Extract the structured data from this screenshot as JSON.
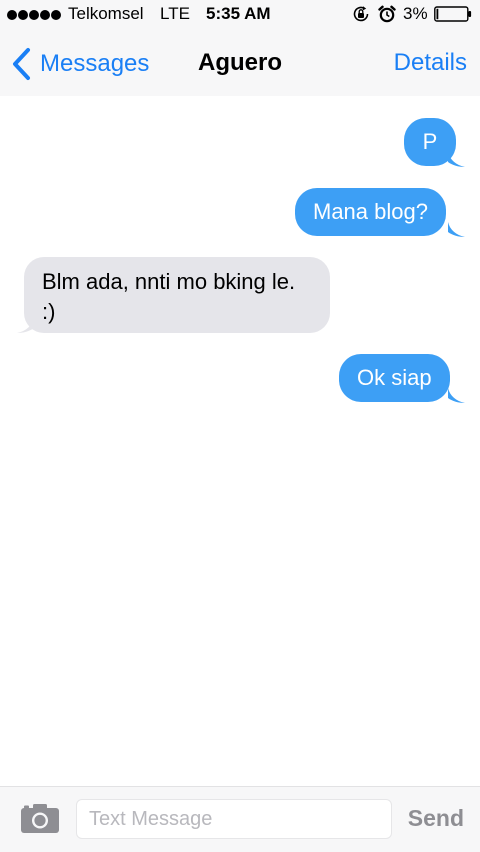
{
  "status_bar": {
    "carrier": "Telkomsel",
    "network": "LTE",
    "time": "5:35 AM",
    "battery_percent": "3%",
    "signal_bars": 5,
    "icons": [
      "signal-dots-icon",
      "rotation-lock-icon",
      "alarm-clock-icon",
      "battery-icon"
    ]
  },
  "nav": {
    "back_label": "Messages",
    "title": "Aguero",
    "details_label": "Details"
  },
  "messages": [
    {
      "direction": "outgoing",
      "text": "P"
    },
    {
      "direction": "outgoing",
      "text": "Mana blog?"
    },
    {
      "direction": "incoming",
      "text": "Blm ada, nnti mo bking le. :)"
    },
    {
      "direction": "outgoing",
      "text": "Ok siap"
    }
  ],
  "composer": {
    "placeholder": "Text Message",
    "value": "",
    "send_label": "Send"
  },
  "colors": {
    "accent": "#1a7ff5",
    "outgoing_bubble": "#3d9ff5",
    "incoming_bubble": "#e5e5ea",
    "bar_background": "#f7f7f8"
  }
}
